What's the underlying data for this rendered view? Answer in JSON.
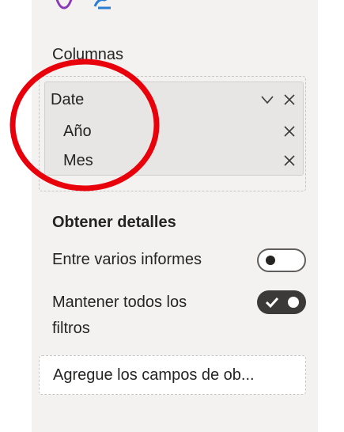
{
  "top_icons": [
    "heart-icon",
    "link-icon"
  ],
  "columns_section": {
    "label": "Columnas",
    "field": {
      "name": "Date",
      "children": [
        {
          "label": "Año"
        },
        {
          "label": "Mes"
        }
      ]
    }
  },
  "drillthrough": {
    "title": "Obtener detalles",
    "cross_report": {
      "label": "Entre varios informes",
      "state": "off"
    },
    "keep_filters": {
      "label_line1": "Mantener todos los",
      "label_line2": "filtros",
      "state": "on"
    },
    "drop_placeholder": "Agregue los campos de ob..."
  },
  "colors": {
    "panel_bg": "#f3f2f1",
    "annotation_red": "#e8000b",
    "toggle_on": "#3b3a39"
  }
}
